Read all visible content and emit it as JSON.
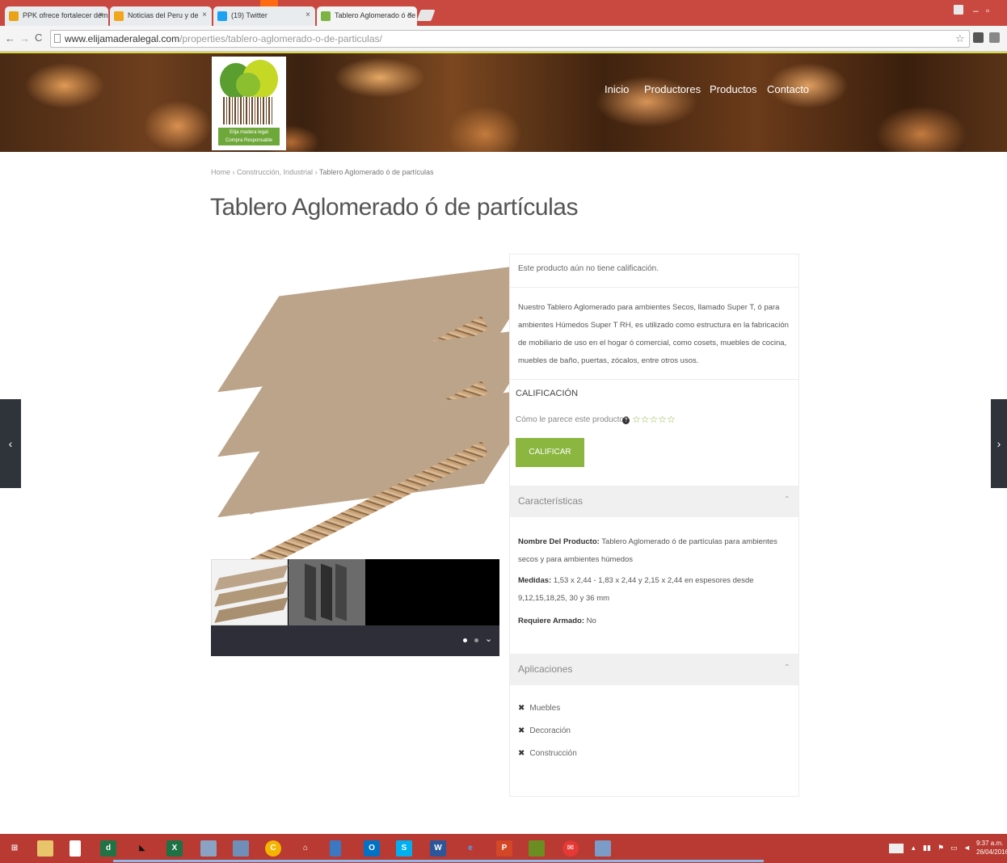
{
  "browser": {
    "tabs": [
      {
        "label": "PPK ofrece fortalecer dem",
        "color": "#e8a317"
      },
      {
        "label": "Noticias del Peru y de",
        "color": "#f3a51c"
      },
      {
        "label": "(19) Twitter",
        "color": "#1da1f2"
      },
      {
        "label": "Tablero Aglomerado ó de",
        "color": "#7cb342"
      }
    ],
    "url_host": "www.elijamaderalegal.com",
    "url_path": "/properties/tablero-aglomerado-o-de-particulas/"
  },
  "site": {
    "logo_caption_1": "Elija madera legal",
    "logo_caption_2": "Compra Responsable",
    "nav": [
      "Inicio",
      "Productores",
      "Productos",
      "Contacto"
    ]
  },
  "breadcrumb": {
    "home": "Home",
    "sep": " › ",
    "category": "Construcción, Industrial",
    "current": "Tablero Aglomerado ó de partículas"
  },
  "page_title": "Tablero Aglomerado ó de partículas",
  "product": {
    "no_rating": "Este producto aún no tiene calificación.",
    "description": "Nuestro Tablero Aglomerado para ambientes Secos, llamado Super T, ó para ambientes Húmedos Super T RH, es utilizado como estructura en la fabricación de mobiliario de uso en el hogar ó comercial, como cosets, muebles de cocina, muebles de baño, puertas, zócalos, entre otros usos.",
    "rating_heading": "CALIFICACIÓN",
    "rating_question": "Cómo le parece este producto?",
    "rating_help": "?",
    "stars": "☆☆☆☆☆",
    "rate_button": "CALIFICAR",
    "characteristics_heading": "Características",
    "specs": [
      {
        "label": "Nombre Del Producto:",
        "value": " Tablero Aglomerado ó de partículas para ambientes secos y para ambientes húmedos"
      },
      {
        "label": "Medidas:",
        "value": " 1,53 x 2,44 - 1,83 x 2,44 y 2,15 x 2,44 en espesores desde 9,12,15,18,25, 30 y 36 mm"
      },
      {
        "label": "Requiere Armado:",
        "value": " No"
      }
    ],
    "applications_heading": "Aplicaciones",
    "applications": [
      "Muebles",
      "Decoración",
      "Construcción"
    ]
  },
  "gallery": {
    "dots": 2
  },
  "taskbar": {
    "clock_time": "9:37 a.m.",
    "clock_date": "26/04/2016"
  },
  "colors": {
    "accent": "#8bb640",
    "taskbar": "#b83a32",
    "tabbar": "#c9483f"
  }
}
